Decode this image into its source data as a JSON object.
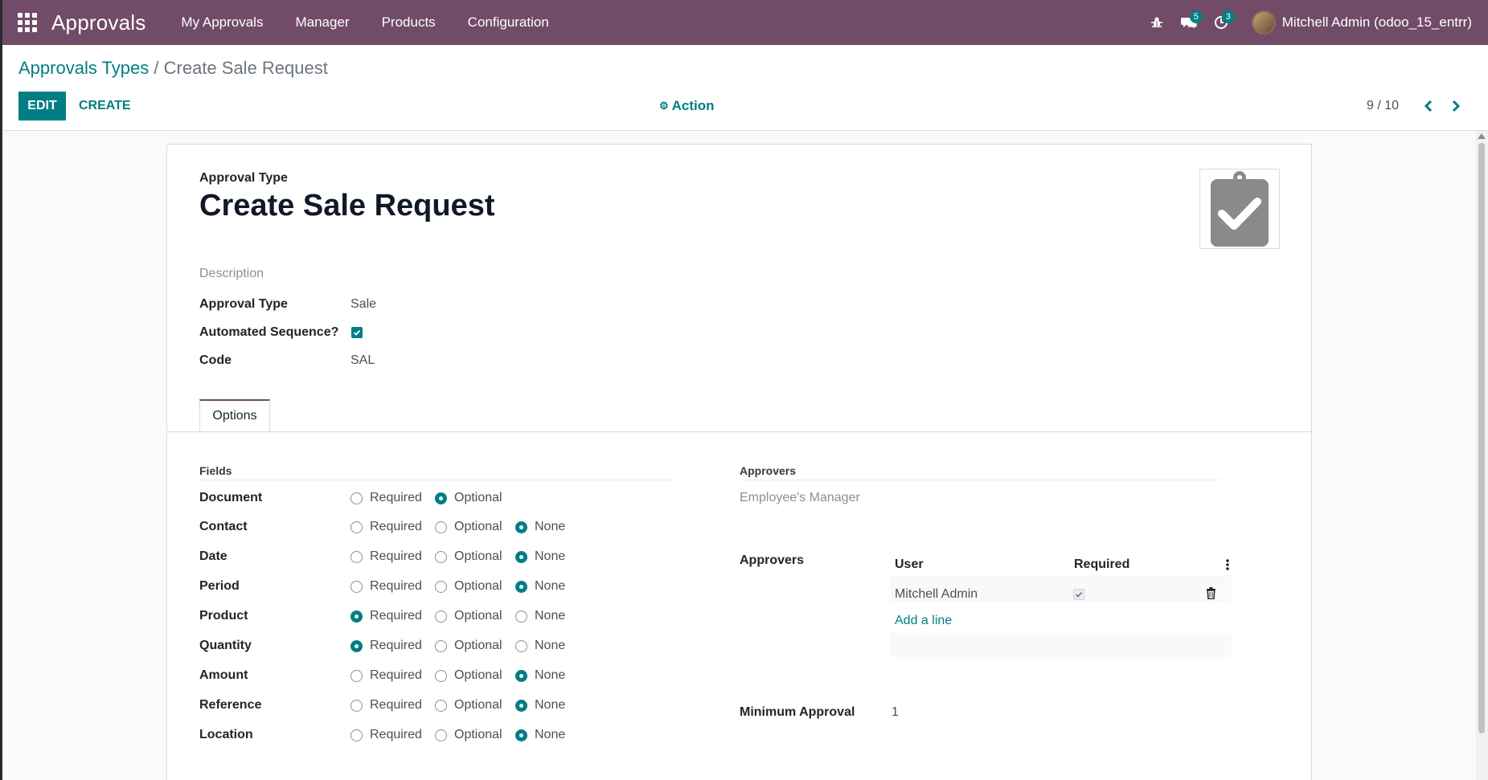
{
  "navbar": {
    "app_title": "Approvals",
    "menu": [
      "My Approvals",
      "Manager",
      "Products",
      "Configuration"
    ],
    "messages_count": "5",
    "activities_count": "3",
    "user": "Mitchell Admin (odoo_15_entrr)"
  },
  "breadcrumb": {
    "parent": "Approvals Types",
    "separator": "/",
    "current": "Create Sale Request"
  },
  "control_panel": {
    "edit_label": "EDIT",
    "create_label": "CREATE",
    "action_label": "Action",
    "pager": "9 / 10"
  },
  "form": {
    "type_label": "Approval Type",
    "name": "Create Sale Request",
    "description_placeholder": "Description",
    "approval_type_label": "Approval Type",
    "approval_type_value": "Sale",
    "automated_sequence_label": "Automated Sequence?",
    "automated_sequence_checked": true,
    "code_label": "Code",
    "code_value": "SAL"
  },
  "tabs": [
    "Options"
  ],
  "fields_section": {
    "title": "Fields",
    "option_labels": [
      "Required",
      "Optional",
      "None"
    ],
    "rows": [
      {
        "label": "Document",
        "selected": "Optional",
        "options": [
          "Required",
          "Optional"
        ]
      },
      {
        "label": "Contact",
        "selected": "None",
        "options": [
          "Required",
          "Optional",
          "None"
        ]
      },
      {
        "label": "Date",
        "selected": "None",
        "options": [
          "Required",
          "Optional",
          "None"
        ]
      },
      {
        "label": "Period",
        "selected": "None",
        "options": [
          "Required",
          "Optional",
          "None"
        ]
      },
      {
        "label": "Product",
        "selected": "Required",
        "options": [
          "Required",
          "Optional",
          "None"
        ]
      },
      {
        "label": "Quantity",
        "selected": "Required",
        "options": [
          "Required",
          "Optional",
          "None"
        ]
      },
      {
        "label": "Amount",
        "selected": "None",
        "options": [
          "Required",
          "Optional",
          "None"
        ]
      },
      {
        "label": "Reference",
        "selected": "None",
        "options": [
          "Required",
          "Optional",
          "None"
        ]
      },
      {
        "label": "Location",
        "selected": "None",
        "options": [
          "Required",
          "Optional",
          "None"
        ]
      }
    ]
  },
  "approvers_section": {
    "title": "Approvers",
    "manager_value": "Employee's Manager",
    "approvers_label": "Approvers",
    "columns": [
      "User",
      "Required"
    ],
    "rows": [
      {
        "user": "Mitchell Admin",
        "required": true
      }
    ],
    "add_line": "Add a line",
    "minimum_label": "Minimum Approval",
    "minimum_value": "1"
  },
  "colors": {
    "brand": "#714B67",
    "accent": "#017e84"
  }
}
